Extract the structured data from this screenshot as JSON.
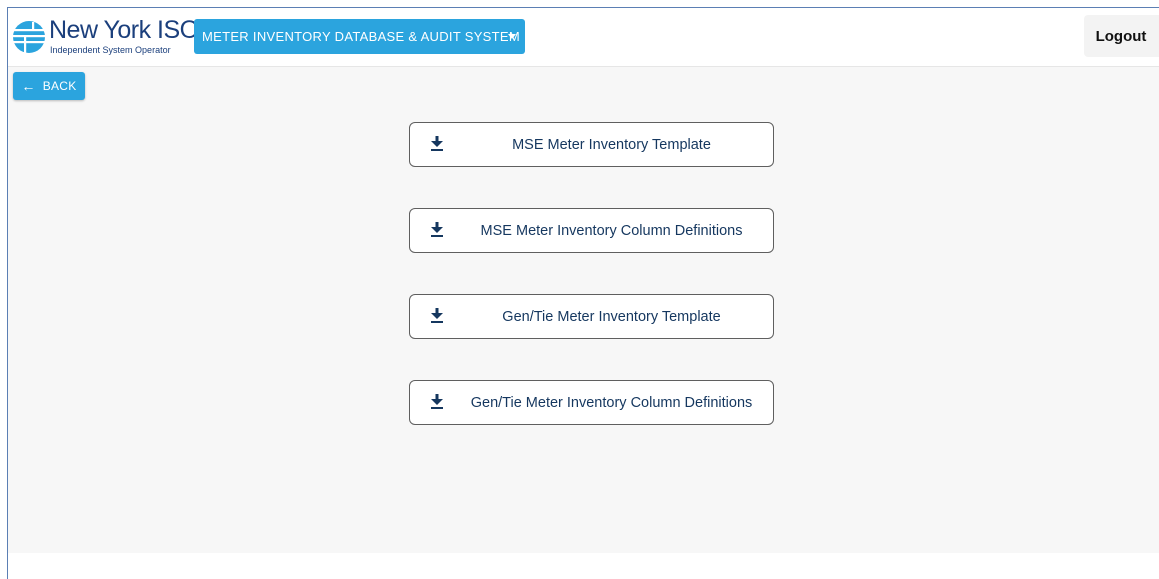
{
  "header": {
    "logo_title": "New York ISO",
    "logo_subtitle": "Independent System Operator",
    "system_menu_label": "METER INVENTORY DATABASE & AUDIT SYSTEM",
    "logout_label": "Logout"
  },
  "content": {
    "back_label": "BACK",
    "downloads": [
      {
        "label": "MSE Meter Inventory Template",
        "icon": "download-icon"
      },
      {
        "label": "MSE Meter Inventory Column Definitions",
        "icon": "download-icon"
      },
      {
        "label": "Gen/Tie Meter Inventory Template",
        "icon": "download-icon"
      },
      {
        "label": "Gen/Tie Meter Inventory Column Definitions",
        "icon": "download-icon"
      }
    ]
  },
  "colors": {
    "accent": "#2ba4de",
    "brand": "#1b3f7c",
    "button_text": "#15375f",
    "content_bg": "#f7f7f7"
  }
}
